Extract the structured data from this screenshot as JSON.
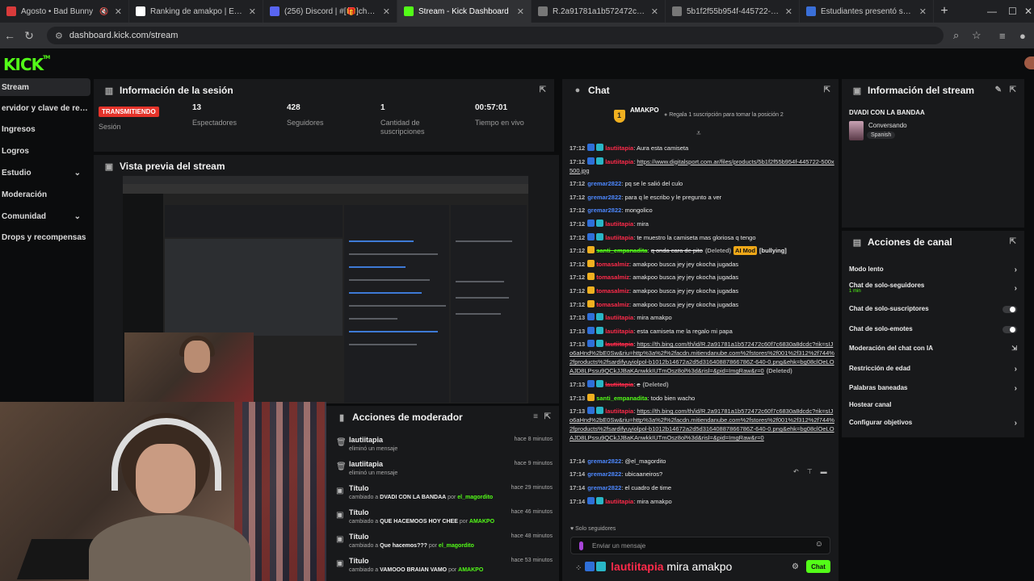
{
  "browser": {
    "tabs": [
      {
        "title": "Agosto • Bad Bunny",
        "color": "#d93b3b",
        "extra": "🔇"
      },
      {
        "title": "Ranking de amakpo | El mejor a",
        "color": "#ffffff"
      },
      {
        "title": "(256) Discord | #[🎁]charla | C",
        "color": "#5865f2"
      },
      {
        "title": "Stream - Kick Dashboard",
        "color": "#53fc18",
        "active": true
      },
      {
        "title": "R.2a91781a1b572472c60f7c68",
        "color": "#777777"
      },
      {
        "title": "5b1f2f55b954f-445722-500x50",
        "color": "#777777"
      },
      {
        "title": "Estudiantes presentó su nueva",
        "color": "#3a6fd8"
      }
    ],
    "url": "dashboard.kick.com/stream",
    "window_min": "—",
    "window_max": "☐",
    "window_close": "✕"
  },
  "brand": {
    "logo": "KICK",
    "tm": "TM"
  },
  "sidebar": {
    "items": [
      {
        "label": "Stream",
        "active": true
      },
      {
        "label": "ervidor y clave de retransm"
      },
      {
        "label": "Ingresos"
      },
      {
        "label": "Logros"
      },
      {
        "label": "Estudio",
        "chev": "⌄"
      },
      {
        "label": "Moderación"
      },
      {
        "label": "Comunidad",
        "chev": "⌄"
      },
      {
        "label": "Drops y recompensas"
      }
    ]
  },
  "session": {
    "title": "Información de la sesión",
    "live_badge": "TRANSMITIENDO",
    "live_label": "Sesión",
    "viewers": "13",
    "viewers_label": "Espectadores",
    "followers": "428",
    "followers_label": "Seguidores",
    "subs": "1",
    "subs_label": "Cantidad de suscripciones",
    "uptime": "00:57:01",
    "uptime_label": "Tiempo en vivo"
  },
  "preview": {
    "title": "Vista previa del stream"
  },
  "mod_actions": {
    "title": "Acciones de moderador",
    "items": [
      {
        "who": "lautiitapia",
        "what": "eliminó un mensaje",
        "when": "hace 8 minutos",
        "icon": "🗑"
      },
      {
        "who": "lautiitapia",
        "what": "eliminó un mensaje",
        "when": "hace 9 minutos",
        "icon": "🗑"
      },
      {
        "who": "Título",
        "pre": "cambiado a",
        "value": "DVADI CON LA BANDAA",
        "by_word": "por",
        "by": "el_magordito",
        "when": "hace 29 minutos",
        "icon": "▣"
      },
      {
        "who": "Título",
        "pre": "cambiado a",
        "value": "QUE HACEMOOS HOY CHEE",
        "by_word": "por",
        "by": "AMAKPO",
        "when": "hace 46 minutos",
        "icon": "▣"
      },
      {
        "who": "Título",
        "pre": "cambiado a",
        "value": "Que hacemos???",
        "by_word": "por",
        "by": "el_magordito",
        "when": "hace 48 minutos",
        "icon": "▣"
      },
      {
        "who": "Título",
        "pre": "cambiado a",
        "value": "VAMOOO BRAIAN VAMO",
        "by_word": "por",
        "by": "AMAKPO",
        "when": "hace 53 minutos",
        "icon": "▣"
      }
    ]
  },
  "chat": {
    "title": "Chat",
    "pinned_rank": "1",
    "pinned_user": "AMAKPO",
    "pinned_text": "Regala 1 suscripción para tomar la posición 2",
    "followers_only": "Solo seguidores",
    "placeholder": "Enviar un mensaje",
    "send": "Chat",
    "deleted_tag": "(Deleted)",
    "ai_tag": "AI Mod",
    "bullying_tag": "[bullying]",
    "lines": [
      {
        "t": "17:12",
        "u": "lautiitapia",
        "c": "red",
        "b": [
          "b1",
          "b2"
        ],
        "m": "Aura esta camiseta"
      },
      {
        "t": "17:12",
        "u": "lautiitapia",
        "c": "red",
        "b": [
          "b1",
          "b2"
        ],
        "m": "https://www.digitalsport.com.ar/files/products/5b1f2f55b954f-445722-500x500.jpg",
        "link": true
      },
      {
        "t": "17:12",
        "u": "gremar2822",
        "c": "blue",
        "m": "pq se le salió del culo"
      },
      {
        "t": "17:12",
        "u": "gremar2822",
        "c": "blue",
        "m": "para q le escribo y le pregunto a ver"
      },
      {
        "t": "17:12",
        "u": "gremar2822",
        "c": "blue",
        "m": "mongolico"
      },
      {
        "t": "17:12",
        "u": "lautiitapia",
        "c": "red",
        "b": [
          "b1",
          "b2"
        ],
        "m": "mira"
      },
      {
        "t": "17:12",
        "u": "lautiitapia",
        "c": "red",
        "b": [
          "b1",
          "b2"
        ],
        "m": "te muestro la camiseta mas gloriosa q tengo"
      },
      {
        "t": "17:12",
        "u": "santi_empanadita",
        "c": "green",
        "b": [
          "b3"
        ],
        "m": "q onda cara de pito",
        "del": true,
        "ai": true
      },
      {
        "t": "17:12",
        "u": "tomasalmiz",
        "c": "red",
        "b": [
          "b3"
        ],
        "m": "amakpoo busca jey jey okocha jugadas"
      },
      {
        "t": "17:12",
        "u": "tomasalmiz",
        "c": "red",
        "b": [
          "b3"
        ],
        "m": "amakpoo busca jey jey okocha jugadas"
      },
      {
        "t": "17:12",
        "u": "tomasalmiz",
        "c": "red",
        "b": [
          "b3"
        ],
        "m": "amakpoo busca jey jey okocha jugadas"
      },
      {
        "t": "17:12",
        "u": "tomasalmiz",
        "c": "red",
        "b": [
          "b3"
        ],
        "m": "amakpoo busca jey jey okocha jugadas"
      },
      {
        "t": "17:13",
        "u": "lautiitapia",
        "c": "red",
        "b": [
          "b1",
          "b2"
        ],
        "m": "mira amakpo"
      },
      {
        "t": "17:13",
        "u": "lautiitapia",
        "c": "red",
        "b": [
          "b1",
          "b2"
        ],
        "m": "esta camiseta me la regalo mi papa"
      },
      {
        "t": "17:13",
        "u": "lautiitapia",
        "c": "red",
        "b": [
          "b1",
          "b2"
        ],
        "m": "https://th.bing.com/th/id/R.2a91781a1b572472c60f7c6830a8dcdc?rik=sIJo6aHnd%2bE0Sw&riu=http%3a%2f%2facdn.mitiendanube.com%2fstores%2f001%2f312%2f744%2fproducts%2fsardifyuyiolpol-b1012b14672a2d5d31640887866786Z-640-0.png&ehk=bg08clOeLOAJD8LPssu9QCkJJBaKAnwkkIUTmOsz8ol%3d&risl=&pid=ImgRaw&r=0",
        "link": true,
        "del": true,
        "h": 44
      },
      {
        "t": "17:13",
        "u": "lautiitapia",
        "c": "red",
        "b": [
          "b1",
          "b2"
        ],
        "m": "e",
        "del": true
      },
      {
        "t": "17:13",
        "u": "santi_empanadita",
        "c": "green",
        "b": [
          "b3"
        ],
        "m": "todo bien wacho"
      },
      {
        "t": "17:13",
        "u": "lautiitapia",
        "c": "red",
        "b": [
          "b1",
          "b2"
        ],
        "m": "https://th.bing.com/th/id/R.2a91781a1b572472c60f7c6830a8dcdc?rik=sIJo6aHnd%2bE0Sw&riu=http%3a%2f%2facdn.mitiendanube.com%2fstores%2f001%2f312%2f744%2fproducts%2fsardifyuyiolpol-b1012b14672a2d5d31640887866786Z-640-0.png&ehk=bg08clOeLOAJD8LPssu9QCkJJBaKAnwkkIUTmOsz8ol%3d&risl=&pid=ImgRaw&r=0",
        "link": true,
        "h": 56
      },
      {
        "t": "17:14",
        "u": "gremar2822",
        "c": "blue",
        "m": "@el_magordito"
      },
      {
        "t": "17:14",
        "u": "gremar2822",
        "c": "blue",
        "m": "ubicaaneiros?"
      },
      {
        "t": "17:14",
        "u": "gremar2822",
        "c": "blue",
        "m": "el cuadro de time"
      },
      {
        "t": "17:14",
        "u": "lautiitapia",
        "c": "red",
        "b": [
          "b1",
          "b2"
        ],
        "m": "mira amakpo"
      }
    ],
    "overlay_user": "lautiitapia",
    "overlay_msg": "mira amakpo"
  },
  "stream_info": {
    "title": "Información del stream",
    "stream_title": "DVADI CON LA BANDAA",
    "category": "Conversando",
    "language": "Spanish"
  },
  "channel_actions": {
    "title": "Acciones de canal",
    "items": [
      {
        "label": "Modo lento",
        "ctl": "chev"
      },
      {
        "label": "Chat de solo-seguidores",
        "sub": "1 min",
        "ctl": "chev"
      },
      {
        "label": "Chat de solo-suscriptores",
        "ctl": "toggle"
      },
      {
        "label": "Chat de solo-emotes",
        "ctl": "toggle"
      },
      {
        "label": "Moderación del chat con IA",
        "ctl": "ext"
      },
      {
        "label": "Restricción de edad",
        "ctl": "chev"
      },
      {
        "label": "Palabras baneadas",
        "ctl": "chev"
      },
      {
        "label": "Hostear canal",
        "ctl": "none"
      },
      {
        "label": "Configurar objetivos",
        "ctl": "chev"
      }
    ]
  },
  "colors": {
    "accent": "#53fc18",
    "live": "#e5332a",
    "panel": "#18191b"
  }
}
